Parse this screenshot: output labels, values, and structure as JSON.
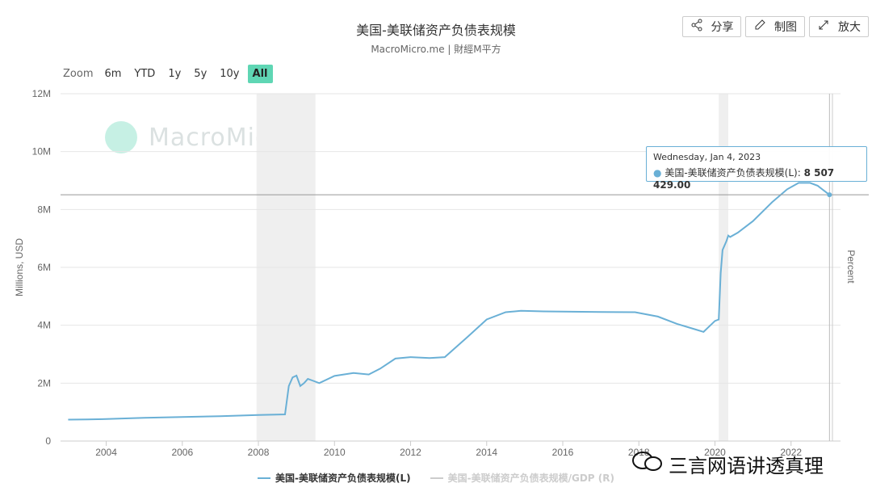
{
  "header": {
    "title": "美国-美联储资产负债表规模",
    "subtitle": "MacroMicro.me | 財經M平方"
  },
  "toolbar": {
    "share_label": "分享",
    "chart_label": "制图",
    "enlarge_label": "放大"
  },
  "zoom": {
    "label": "Zoom",
    "options": [
      "6m",
      "YTD",
      "1y",
      "5y",
      "10y",
      "All"
    ],
    "active": "All"
  },
  "watermark": "MacroMicro",
  "tooltip": {
    "date": "Wednesday, Jan 4, 2023",
    "series": "美国-美联储资产负债表规模(L):",
    "value": "8 507 429.00"
  },
  "overlay_text": "三言网语讲透真理",
  "colors": {
    "series": "#6ab0d6",
    "inactive": "#cccccc",
    "recession": "#efefef",
    "accent": "#5fd6b4"
  },
  "chart_data": {
    "type": "line",
    "title": "美国-美联储资产负债表规模",
    "ylabel": "Millions, USD",
    "y2label": "Percent",
    "ylim": [
      0,
      12000000
    ],
    "y_ticks": [
      "0",
      "2M",
      "4M",
      "6M",
      "8M",
      "10M",
      "12M"
    ],
    "x_ticks": [
      "2004",
      "2006",
      "2008",
      "2010",
      "2012",
      "2014",
      "2016",
      "2018",
      "2020",
      "2022"
    ],
    "recession_shading": [
      [
        2007.95,
        2009.5
      ],
      [
        2020.1,
        2020.35
      ]
    ],
    "series": [
      {
        "name": "美国-美联储资产负债表规模(L)",
        "x": [
          2003.0,
          2003.5,
          2004.0,
          2005.0,
          2006.0,
          2007.0,
          2008.0,
          2008.7,
          2008.8,
          2008.9,
          2009.0,
          2009.1,
          2009.2,
          2009.3,
          2009.5,
          2009.6,
          2010.0,
          2010.5,
          2010.9,
          2011.2,
          2011.6,
          2012.0,
          2012.5,
          2012.9,
          2013.5,
          2014.0,
          2014.5,
          2014.9,
          2015.5,
          2016.0,
          2017.0,
          2017.9,
          2018.5,
          2019.0,
          2019.5,
          2019.7,
          2019.8,
          2020.0,
          2020.1,
          2020.15,
          2020.2,
          2020.3,
          2020.35,
          2020.4,
          2020.6,
          2021.0,
          2021.5,
          2021.9,
          2022.2,
          2022.5,
          2022.7,
          2023.01
        ],
        "values": [
          740000,
          745000,
          760000,
          800000,
          830000,
          860000,
          900000,
          920000,
          1900000,
          2200000,
          2260000,
          1900000,
          2000000,
          2150000,
          2050000,
          2000000,
          2250000,
          2350000,
          2300000,
          2500000,
          2850000,
          2900000,
          2870000,
          2900000,
          3600000,
          4200000,
          4450000,
          4500000,
          4480000,
          4470000,
          4460000,
          4450000,
          4300000,
          4050000,
          3850000,
          3770000,
          3900000,
          4150000,
          4200000,
          5800000,
          6600000,
          6900000,
          7100000,
          7050000,
          7200000,
          7600000,
          8250000,
          8700000,
          8920000,
          8920000,
          8820000,
          8507429
        ]
      },
      {
        "name": "美国-美联储资产负债表规模/GDP (R)",
        "x": [],
        "values": [],
        "hidden": true
      }
    ],
    "legend_position": "bottom",
    "crosshair": {
      "x": 2023.01,
      "y": 8507429
    }
  }
}
